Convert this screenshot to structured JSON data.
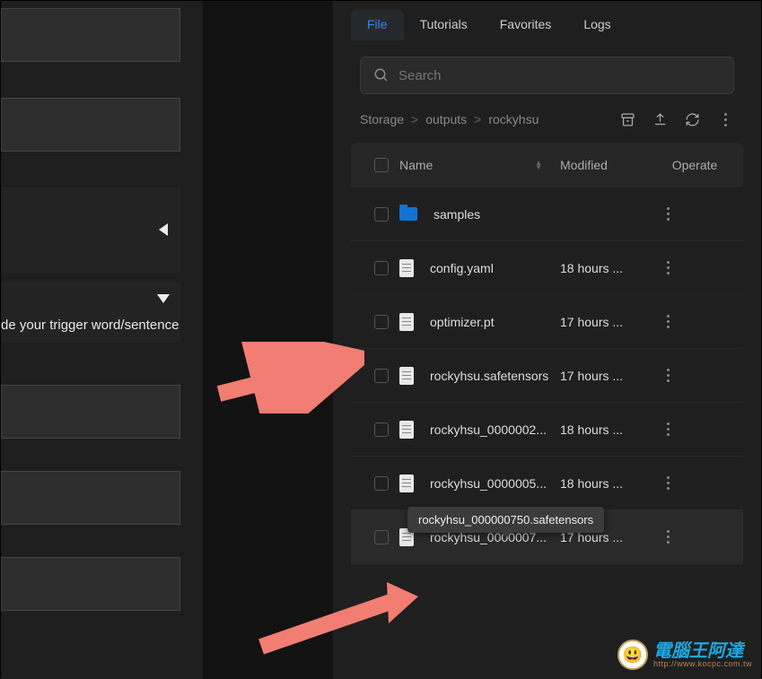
{
  "left": {
    "collapse_left_title": "",
    "collapse_down_title": "",
    "trigger_label": "de your trigger word/sentence"
  },
  "tabs": [
    {
      "id": "file",
      "label": "File",
      "active": true
    },
    {
      "id": "tutorials",
      "label": "Tutorials",
      "active": false
    },
    {
      "id": "favorites",
      "label": "Favorites",
      "active": false
    },
    {
      "id": "logs",
      "label": "Logs",
      "active": false
    }
  ],
  "search": {
    "placeholder": "Search"
  },
  "breadcrumbs": [
    "Storage",
    "outputs",
    "rockyhsu"
  ],
  "columns": {
    "name": "Name",
    "modified": "Modified",
    "operate": "Operate"
  },
  "files": [
    {
      "kind": "folder",
      "name": "samples",
      "modified": ""
    },
    {
      "kind": "file",
      "name": "config.yaml",
      "modified": "18 hours ..."
    },
    {
      "kind": "file",
      "name": "optimizer.pt",
      "modified": "17 hours ..."
    },
    {
      "kind": "file",
      "name": "rockyhsu.safetensors",
      "modified": "17 hours ..."
    },
    {
      "kind": "file",
      "name": "rockyhsu_0000002...",
      "modified": "18 hours ..."
    },
    {
      "kind": "file",
      "name": "rockyhsu_0000005...",
      "modified": "18 hours ..."
    },
    {
      "kind": "file",
      "name": "rockyhsu_0000007...",
      "modified": "17 hours ..."
    }
  ],
  "tooltip": "rockyhsu_000000750.safetensors",
  "watermark": "電腦王阿達"
}
